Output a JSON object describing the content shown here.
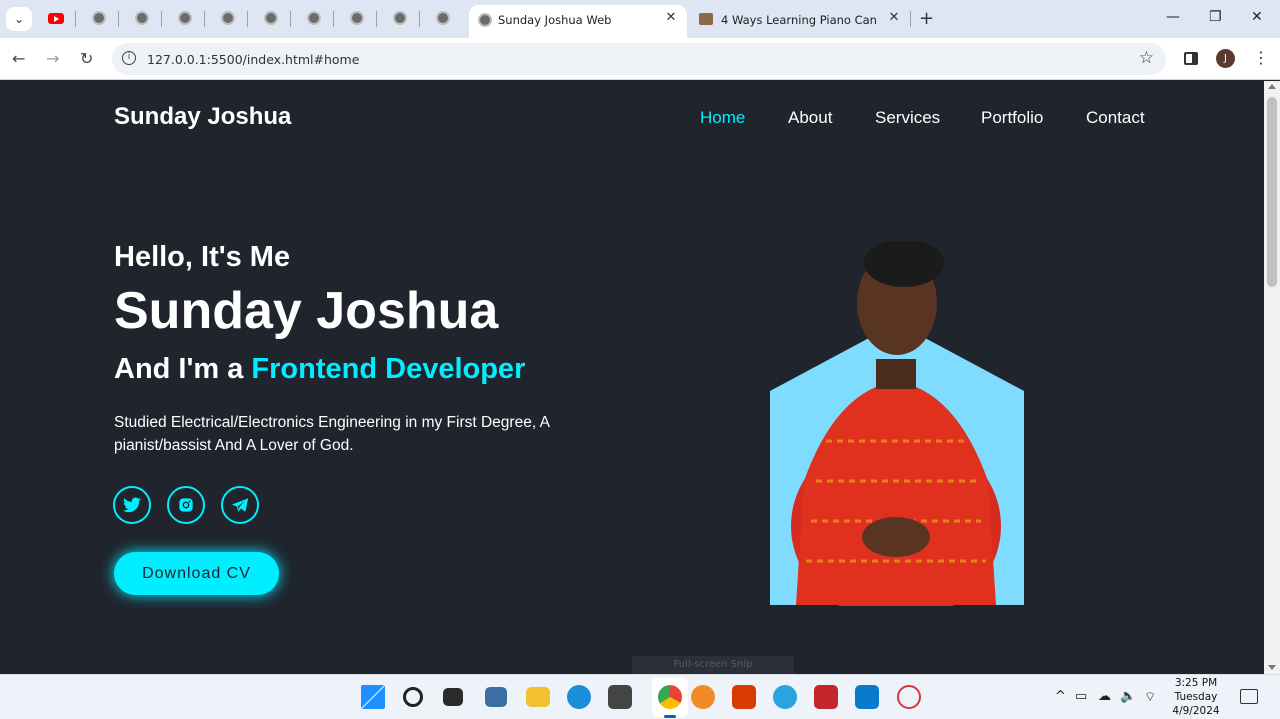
{
  "browser": {
    "active_tab_title": "Sunday Joshua Web",
    "other_tab_title": "4 Ways Learning Piano Can Mak",
    "url": "127.0.0.1:5500/index.html#home",
    "profile_initial": "J"
  },
  "site": {
    "logo": "Sunday Joshua",
    "nav": [
      "Home",
      "About",
      "Services",
      "Portfolio",
      "Contact"
    ],
    "active_nav": "Home",
    "hero": {
      "greeting": "Hello, It's Me",
      "name": "Sunday Joshua",
      "role_prefix": "And I'm a ",
      "role_highlight": "Frontend Developer",
      "description": "Studied Electrical/Electronics Engineering in my First Degree, A pianist/bassist And A Lover of God.",
      "social_icons": [
        "twitter-icon",
        "instagram-icon",
        "telegram-icon"
      ],
      "cta_label": "Download CV"
    },
    "accent_color": "#00eeff",
    "background_color": "#1f242d",
    "portrait_bg_color": "#7fdcff"
  },
  "overlay": {
    "snip_text": "Full-screen Snip"
  },
  "taskbar": {
    "time": "3:25 PM",
    "day": "Tuesday",
    "date": "4/9/2024"
  }
}
